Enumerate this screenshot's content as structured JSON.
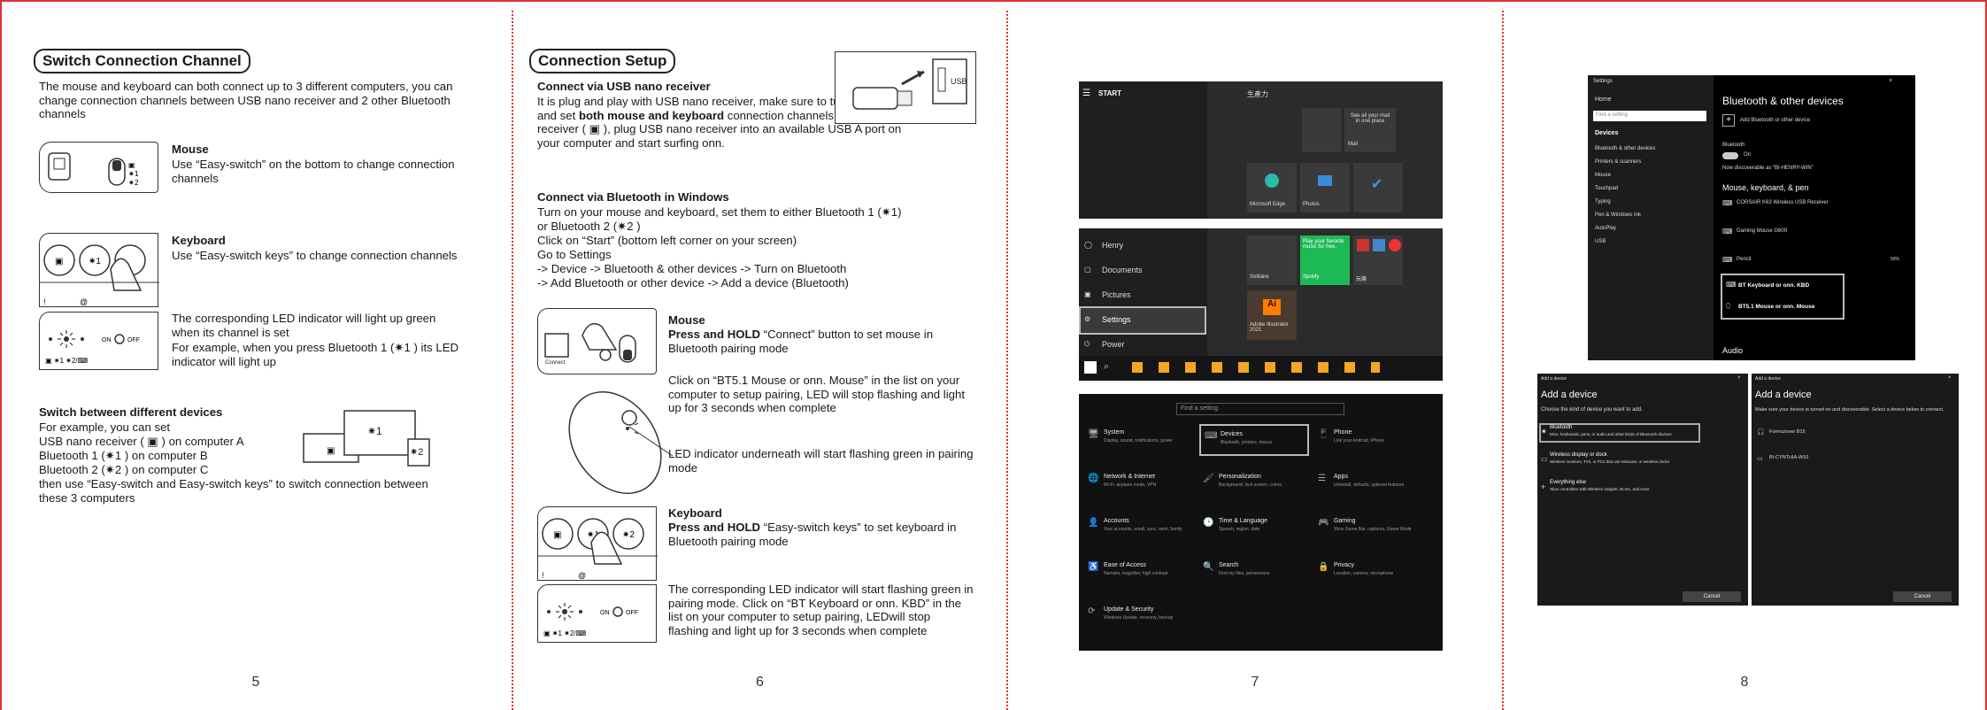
{
  "page5": {
    "title": "Switch Connection Channel",
    "intro": "The mouse and keyboard can both connect up to 3 different computers, you can change connection channels between USB nano receiver and 2 other Bluetooth channels",
    "mouse_heading": "Mouse",
    "mouse_text": "Use “Easy-switch” on the bottom to change connection channels",
    "keyboard_heading": "Keyboard",
    "keyboard_text": "Use “Easy-switch keys” to change connection channels",
    "led_text1": "The corresponding LED indicator will light up green when its channel is set",
    "led_text2": "For example, when you press Bluetooth 1 (✷1 ) its LED indicator will light up",
    "switch_heading": "Switch between different devices",
    "switch_lines": [
      "For example, you can set",
      "USB nano receiver ( ▣ ) on computer A",
      "Bluetooth 1 (✷1 ) on computer B",
      "Bluetooth 2 (✷2 ) on computer C",
      "then use “Easy-switch and Easy-switch keys” to switch connection between these 3 computers"
    ],
    "label_1": "✷1",
    "label_2": "✷2",
    "switch_labels": [
      "✷1",
      "✷2"
    ],
    "led_labels": "ON",
    "led_off": "OFF",
    "led_bottom": "▣ ✷1 ✷2/⌨",
    "page_number": "5"
  },
  "page6": {
    "title": "Connection Setup",
    "usb_heading": "Connect via USB nano receiver",
    "usb_text_a": "It is plug and play with USB nano receiver, make sure to turn on power and set ",
    "usb_text_b": "both mouse and keyboard",
    "usb_text_c": " connection channels on USB nano receiver ( ▣ ), plug USB nano receiver into an available  USB A port on your computer and start surfing onn.",
    "usb_label": "USB",
    "bt_heading": "Connect via Bluetooth in Windows",
    "bt_lines": [
      "Turn on your mouse and keyboard, set them to either Bluetooth 1 (✷1)",
      "or Bluetooth 2 (✷2 )",
      "Click on “Start” (bottom left corner on your screen)",
      "Go to Settings",
      "-> Device -> Bluetooth & other devices -> Turn on Bluetooth",
      "-> Add Bluetooth or other device -> Add a device (Bluetooth)"
    ],
    "mouse_heading": "Mouse",
    "mouse_hold": "Press and HOLD",
    "mouse_text": " “Connect” button to set mouse in Bluetooth pairing mode",
    "mouse_click": "Click on “BT5.1 Mouse or onn. Mouse” in the list on your computer to setup pairing, LED will stop flashing and light up for 3 seconds when complete",
    "mouse_led": "LED indicator underneath will start flashing green in pairing mode",
    "connect_label": "Connect",
    "kb_heading": "Keyboard",
    "kb_hold": "Press and HOLD",
    "kb_text": " “Easy-switch keys” to set keyboard in Bluetooth pairing mode",
    "kb_led": "The corresponding LED indicator will start flashing green in pairing mode. Click on “BT Keyboard or onn. KBD” in the list on your computer to setup pairing, LEDwill stop flashing and light up for 3 seconds when complete",
    "page_number": "6"
  },
  "page7": {
    "start_label": "START",
    "start_right_label": "生產力",
    "mail_text": "See all your mail in one place",
    "mail_label": "Mail",
    "edge_label": "Microsoft Edge",
    "photos_label": "Photos",
    "user_label": "Henry",
    "menu_items": [
      "Documents",
      "Pictures",
      "Settings",
      "Power"
    ],
    "solitaire_label": "Solitaire",
    "spotify_text": "Play your favorite music for free.",
    "spotify_label": "Spotify",
    "game_label": "玩樂",
    "illustrator_label": "Adobe Illustrator 2021",
    "ai_label": "Ai",
    "search_placeholder": "Find a setting",
    "settings_tiles": [
      {
        "name": "System",
        "desc": "Display, sound, notifications, power"
      },
      {
        "name": "Devices",
        "desc": "Bluetooth, printers, mouse"
      },
      {
        "name": "Phone",
        "desc": "Link your Android, iPhone"
      },
      {
        "name": "Network & Internet",
        "desc": "Wi-Fi, airplane mode, VPN"
      },
      {
        "name": "Personalization",
        "desc": "Background, lock screen, colors"
      },
      {
        "name": "Apps",
        "desc": "Uninstall, defaults, optional features"
      },
      {
        "name": "Accounts",
        "desc": "Your accounts, email, sync, work, family"
      },
      {
        "name": "Time & Language",
        "desc": "Speech, region, date"
      },
      {
        "name": "Gaming",
        "desc": "Xbox Game Bar, captures, Game Mode"
      },
      {
        "name": "Ease of Access",
        "desc": "Narrator, magnifier, high contrast"
      },
      {
        "name": "Search",
        "desc": "Find my files, permissions"
      },
      {
        "name": "Privacy",
        "desc": "Location, camera, microphone"
      },
      {
        "name": "Update & Security",
        "desc": "Windows Update, recovery, backup"
      }
    ],
    "page_number": "7"
  },
  "page8": {
    "window_title": "Settings",
    "nav_home": "Home",
    "nav_search": "Find a setting",
    "nav_section": "Devices",
    "nav_items": [
      "Bluetooth & other devices",
      "Printers & scanners",
      "Mouse",
      "Touchpad",
      "Typing",
      "Pen & Windows Ink",
      "AutoPlay",
      "USB"
    ],
    "heading": "Bluetooth & other devices",
    "add_device": "Add Bluetooth or other device",
    "bt_label": "Bluetooth",
    "bt_state": "On",
    "discoverable": "Now discoverable as “BI-HENRY-WIN”",
    "section": "Mouse, keyboard, & pen",
    "devices": [
      "CORSAIR K63 Wireless USB Receiver",
      "Gaming Mouse G600",
      "Pencil"
    ],
    "battery": "50%",
    "highlight_1": "BT Keyboard or onn. KBD",
    "highlight_2": "BT5.1 Mouse or onn. Mouse",
    "audio": "Audio",
    "dialog_title_bar": "Add a device",
    "dialog1_heading": "Add a device",
    "dialog1_sub": "Choose the kind of device you want to add.",
    "dialog1_options": [
      {
        "name": "Bluetooth",
        "desc": "Mice, keyboards, pens, or audio and other kinds of Bluetooth devices"
      },
      {
        "name": "Wireless display or dock",
        "desc": "Wireless monitors, TVs, or PCs that use Miracast, or wireless docks"
      },
      {
        "name": "Everything else",
        "desc": "Xbox controllers with Wireless Adapter, DLNA, and more"
      }
    ],
    "dialog2_heading": "Add a device",
    "dialog2_sub": "Make sure your device is turned on and discoverable. Select a device below to connect.",
    "dialog2_items": [
      "Formuzover B15",
      "BI-CYNTHIA-W10"
    ],
    "cancel": "Cancel",
    "close": "×",
    "page_number": "8"
  },
  "colors": {
    "border": "#dd3333",
    "win_bg": "#1e1e1e",
    "accent": "#0078d7"
  }
}
